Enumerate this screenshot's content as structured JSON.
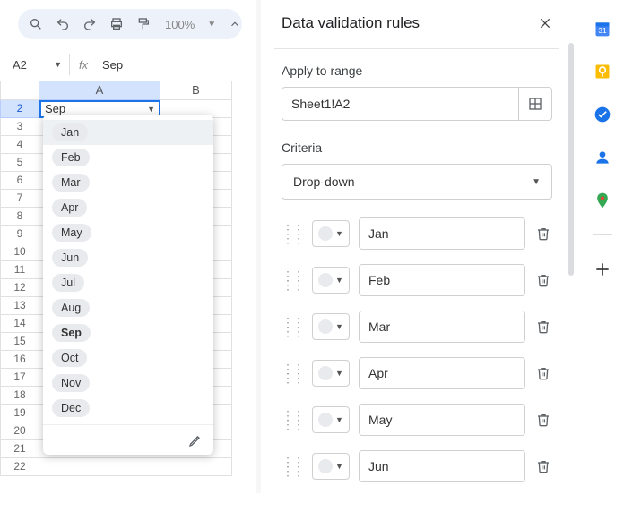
{
  "toolbar": {
    "zoom": "100%"
  },
  "namebox": {
    "ref": "A2"
  },
  "formula": {
    "value": "Sep"
  },
  "grid": {
    "cols": [
      "A",
      "B"
    ],
    "rows": [
      "2",
      "3",
      "4",
      "5",
      "6",
      "7",
      "8",
      "9",
      "10",
      "11",
      "12",
      "13",
      "14",
      "15",
      "16",
      "17",
      "18",
      "19",
      "20",
      "21",
      "22"
    ],
    "active_cell_value": "Sep"
  },
  "dropdown": {
    "items": [
      "Jan",
      "Feb",
      "Mar",
      "Apr",
      "May",
      "Jun",
      "Jul",
      "Aug",
      "Sep",
      "Oct",
      "Nov",
      "Dec"
    ],
    "selected": "Sep",
    "highlight_index": 0
  },
  "panel": {
    "title": "Data validation rules",
    "apply_label": "Apply to range",
    "range": "Sheet1!A2",
    "criteria_label": "Criteria",
    "criteria_value": "Drop-down",
    "options": [
      "Jan",
      "Feb",
      "Mar",
      "Apr",
      "May",
      "Jun"
    ]
  }
}
